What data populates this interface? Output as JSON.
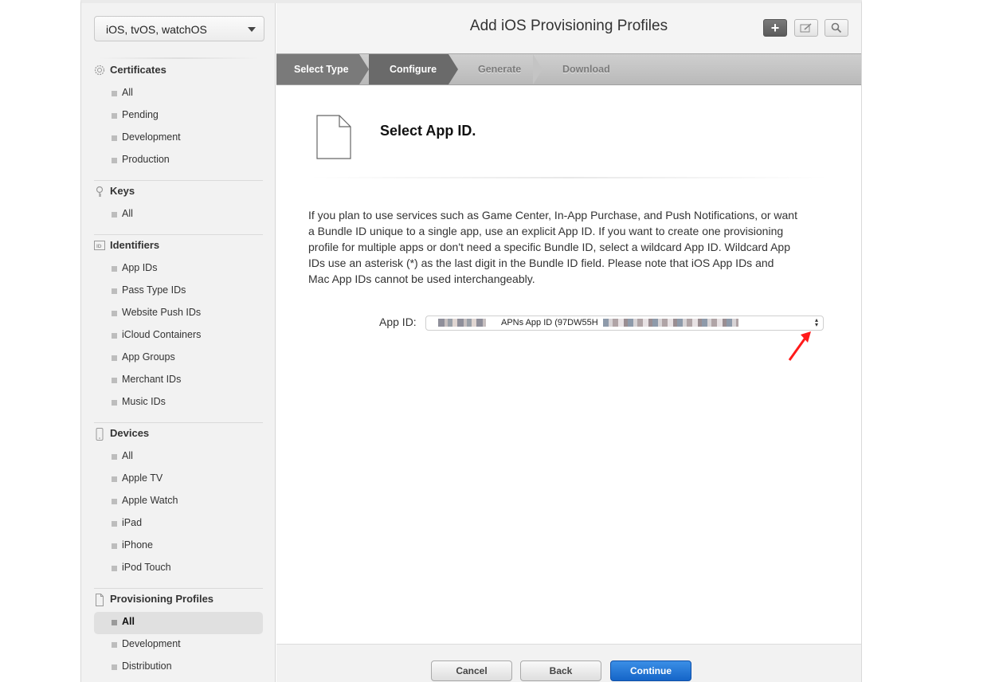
{
  "sidebar": {
    "platform": "iOS, tvOS, watchOS",
    "sections": [
      {
        "title": "Certificates",
        "icon": "certificate-icon",
        "items": [
          "All",
          "Pending",
          "Development",
          "Production"
        ]
      },
      {
        "title": "Keys",
        "icon": "key-icon",
        "items": [
          "All"
        ]
      },
      {
        "title": "Identifiers",
        "icon": "id-icon",
        "items": [
          "App IDs",
          "Pass Type IDs",
          "Website Push IDs",
          "iCloud Containers",
          "App Groups",
          "Merchant IDs",
          "Music IDs"
        ]
      },
      {
        "title": "Devices",
        "icon": "device-icon",
        "items": [
          "All",
          "Apple TV",
          "Apple Watch",
          "iPad",
          "iPhone",
          "iPod Touch"
        ]
      },
      {
        "title": "Provisioning Profiles",
        "icon": "document-icon",
        "items": [
          "All",
          "Development",
          "Distribution"
        ],
        "active_item": "All"
      }
    ]
  },
  "header": {
    "title": "Add iOS Provisioning Profiles",
    "tools": [
      "add-icon",
      "edit-icon",
      "search-icon"
    ]
  },
  "steps": {
    "items": [
      "Select Type",
      "Configure",
      "Generate",
      "Download"
    ],
    "current": "Configure"
  },
  "content": {
    "section_title": "Select App ID.",
    "description": "If you plan to use services such as Game Center, In-App Purchase, and Push Notifications, or want a Bundle ID unique to a single app, use an explicit App ID. If you want to create one provisioning profile for multiple apps or don't need a specific Bundle ID, select a wildcard App ID. Wildcard App IDs use an asterisk (*) as the last digit in the Bundle ID field. Please note that iOS App IDs and Mac App IDs cannot be used interchangeably.",
    "app_id_label": "App ID:",
    "app_id_value": "APNs App ID (97DW55H"
  },
  "footer": {
    "cancel": "Cancel",
    "back": "Back",
    "continue": "Continue"
  },
  "colors": {
    "primary_button": "#1565c8",
    "annotation_arrow": "#ff1a1a"
  }
}
